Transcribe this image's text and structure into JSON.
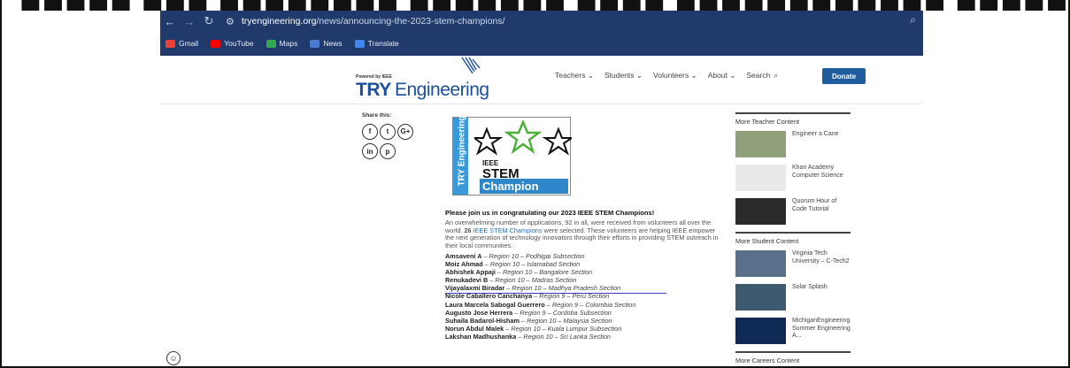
{
  "browser": {
    "url_domain": "tryengineering.org",
    "url_path": "/news/announcing-the-2023-stem-champions/",
    "bookmarks": [
      {
        "label": "Gmail",
        "icon": "gmail-icon",
        "color": "#ea4335"
      },
      {
        "label": "YouTube",
        "icon": "youtube-icon",
        "color": "#ff0000"
      },
      {
        "label": "Maps",
        "icon": "maps-icon",
        "color": "#34a853"
      },
      {
        "label": "News",
        "icon": "news-icon",
        "color": "#4a7bd0"
      },
      {
        "label": "Translate",
        "icon": "translate-icon",
        "color": "#4285f4"
      }
    ]
  },
  "site": {
    "logo_powered": "Powered by IEEE",
    "logo_try": "TRY",
    "logo_engineering": "Engineering",
    "nav": [
      "Teachers ⌄",
      "Students ⌄",
      "Volunteers ⌄",
      "About ⌄",
      "Search"
    ],
    "donate_label": "Donate"
  },
  "share": {
    "label": "Share this:",
    "icons": [
      "facebook-icon",
      "twitter-icon",
      "google-plus-icon",
      "linkedin-icon",
      "pinterest-icon"
    ]
  },
  "champion_logo": {
    "side_text": "TRY Engineering",
    "ieee": "IEEE",
    "stem": "STEM",
    "champion": "Champion"
  },
  "article": {
    "headline": "Please join us in congratulating our 2023 IEEE STEM Champions!",
    "intro_1": "An overwhelming number of applications, 92 in all, were received from volunteers all over the world. ",
    "intro_count": "26",
    "intro_link": "IEEE STEM Champions",
    "intro_2": " were selected. These volunteers are helping IEEE empower the next generation of technology innovators through their efforts in providing STEM outreach in their local communities.",
    "champions": [
      {
        "name": "Amsaveni A",
        "region": "Region 10 – Podhigai Subsection"
      },
      {
        "name": "Moiz Ahmad",
        "region": "Region 10 – Islamabad Section"
      },
      {
        "name": "Abhishek Appaji",
        "region": "Region 10 – Bangalore Section"
      },
      {
        "name": "Renukadevi B",
        "region": "Region 10 – Madras Section"
      },
      {
        "name": "Vijayalaxmi Biradar",
        "region": "Region 10 – Madhya Pradesh Section"
      },
      {
        "name": "Nicole Caballero Canchanya",
        "region": "Region 9 – Peru Section"
      },
      {
        "name": "Laura Marcela Sabogal Guerrero",
        "region": "Region 9 – Colombia Section"
      },
      {
        "name": "Augusto Jose Herrera",
        "region": "Region 9 – Cordoba Subsection"
      },
      {
        "name": "Suhaila Badarol-Hisham",
        "region": "Region 10 – Malaysia Section"
      },
      {
        "name": "Norun Abdul Malek",
        "region": "Region 10 – Kuala Lumpur Subsection"
      },
      {
        "name": "Lakshan Madhushanka",
        "region": "Region 10 – Sri Lanka Section"
      }
    ]
  },
  "sidebar": {
    "teacher_heading": "More Teacher Content",
    "teacher_items": [
      {
        "title": "Engineer a Cane",
        "thumb": "#8fa07a"
      },
      {
        "title": "Khan Academy Computer Science",
        "thumb": "#e9e9e9"
      },
      {
        "title": "Quorum Hour of Code Tutorial",
        "thumb": "#2b2b2b"
      }
    ],
    "student_heading": "More Student Content",
    "student_items": [
      {
        "title": "Virginia Tech University – C-Tech2",
        "thumb": "#5a6f8a"
      },
      {
        "title": "Solar Splash",
        "thumb": "#3d5a6e"
      },
      {
        "title": "MichiganEngineering Summer Engineering A...",
        "thumb": "#0e2a55"
      }
    ],
    "careers_heading": "More Careers Content"
  },
  "top_cropped_text": "■■■■■  ■■■ ■■■■■■■■  ■■■■■■■  ■■■■  ■■■■■■■■■■■■  ■■■■■■■■■■■■■  ■■■■■■■■■  ■■■■■■■  ■■■■■■■  ■■■■■■■■■"
}
